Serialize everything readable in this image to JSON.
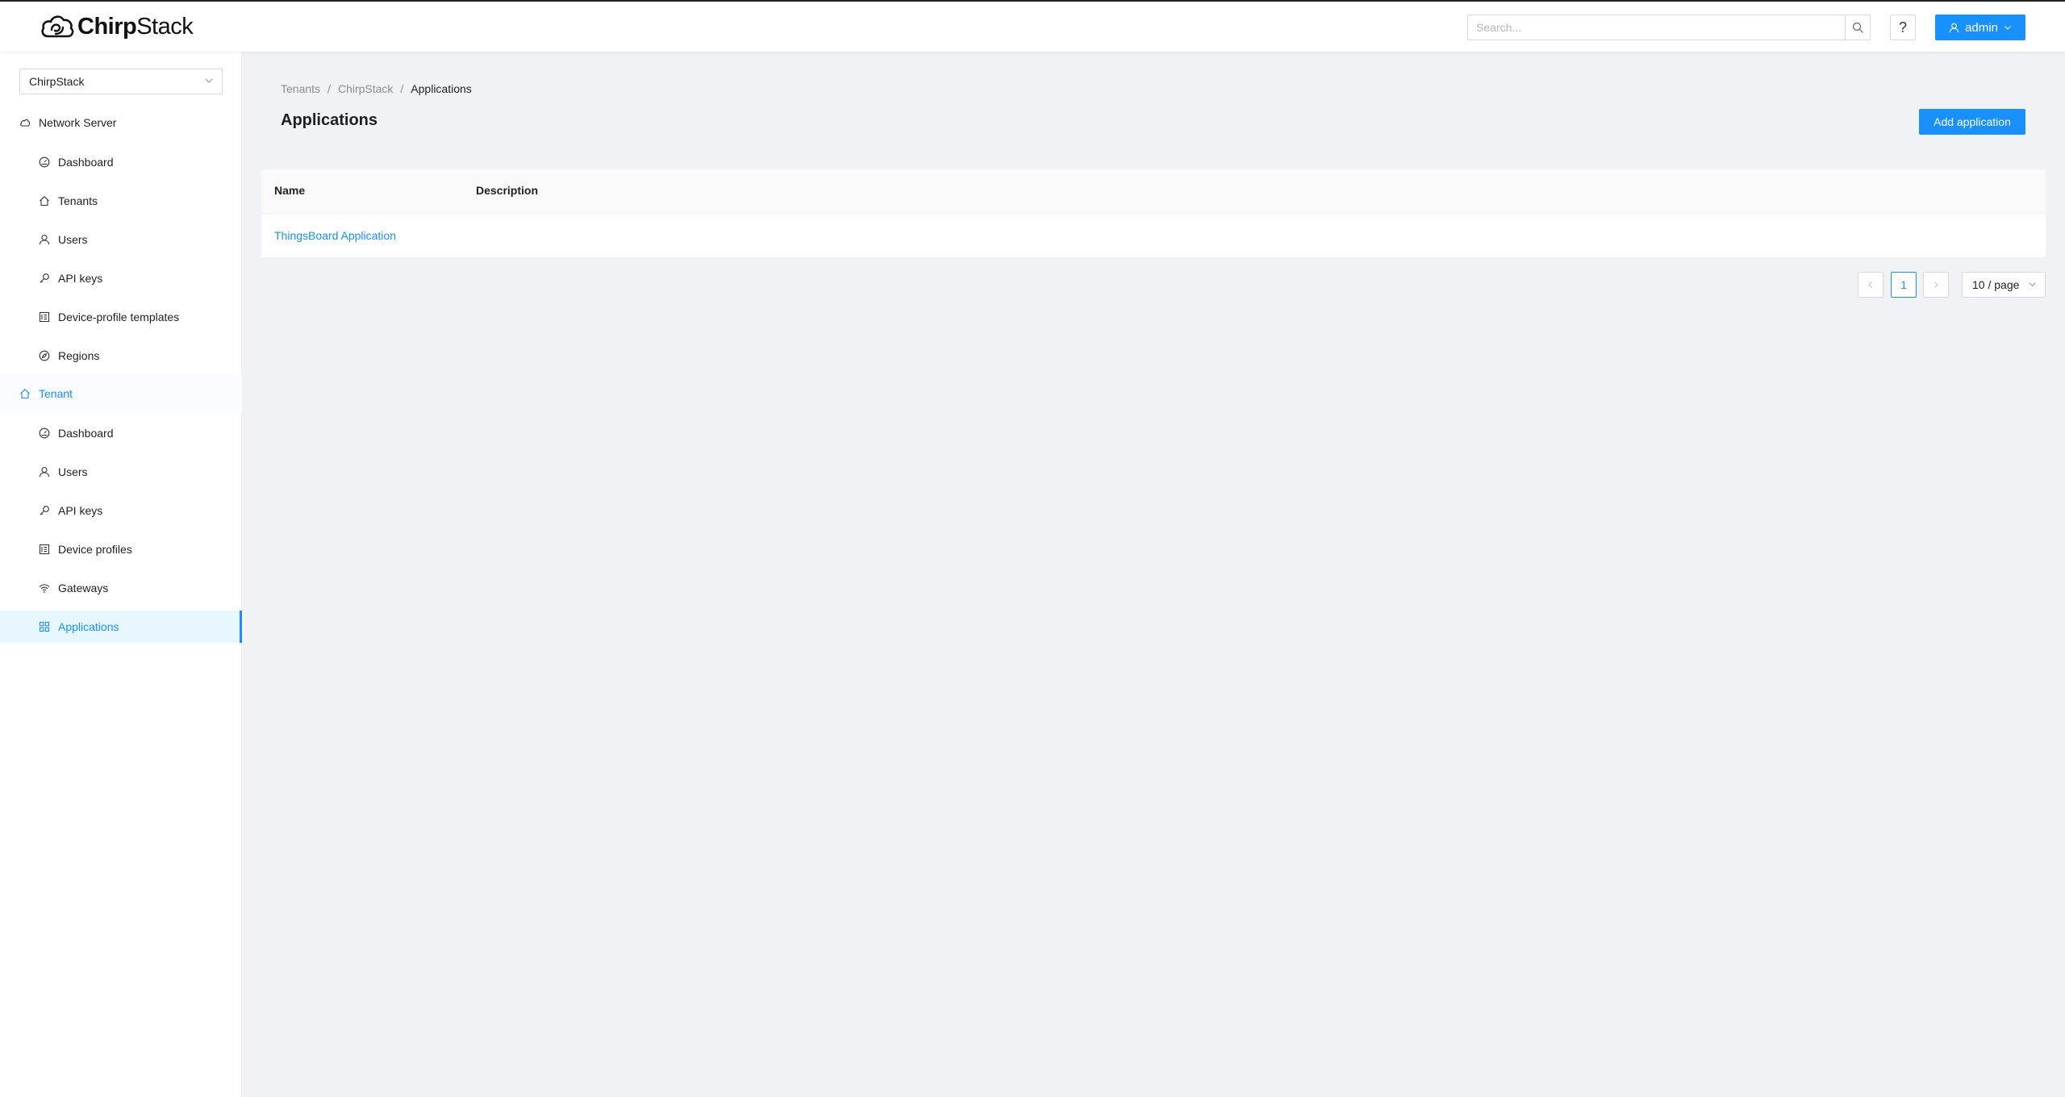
{
  "header": {
    "logo_bold": "Chirp",
    "logo_regular": "Stack",
    "search_placeholder": "Search...",
    "help_label": "?",
    "user_label": "admin"
  },
  "sidebar": {
    "tenant_select": "ChirpStack",
    "network_server": {
      "label": "Network Server",
      "icon": "cloud-icon",
      "items": [
        {
          "label": "Dashboard",
          "icon": "dashboard-icon"
        },
        {
          "label": "Tenants",
          "icon": "home-icon"
        },
        {
          "label": "Users",
          "icon": "user-icon"
        },
        {
          "label": "API keys",
          "icon": "key-icon"
        },
        {
          "label": "Device-profile templates",
          "icon": "profile-icon"
        },
        {
          "label": "Regions",
          "icon": "compass-icon"
        }
      ]
    },
    "tenant": {
      "label": "Tenant",
      "icon": "home-icon",
      "items": [
        {
          "label": "Dashboard",
          "icon": "dashboard-icon"
        },
        {
          "label": "Users",
          "icon": "user-icon"
        },
        {
          "label": "API keys",
          "icon": "key-icon"
        },
        {
          "label": "Device profiles",
          "icon": "profile-icon"
        },
        {
          "label": "Gateways",
          "icon": "wifi-icon"
        },
        {
          "label": "Applications",
          "icon": "appstore-icon"
        }
      ]
    }
  },
  "main": {
    "breadcrumb": [
      "Tenants",
      "ChirpStack",
      "Applications"
    ],
    "breadcrumb_separator": "/",
    "title": "Applications",
    "add_button": "Add application",
    "table": {
      "columns": [
        "Name",
        "Description"
      ],
      "rows": [
        {
          "name": "ThingsBoard Application",
          "description": ""
        }
      ]
    },
    "pagination": {
      "current_page": "1",
      "page_size": "10 / page"
    }
  },
  "colors": {
    "primary": "#1890ff",
    "background": "#f0f2f5",
    "selected_bg": "#e6f7ff"
  }
}
